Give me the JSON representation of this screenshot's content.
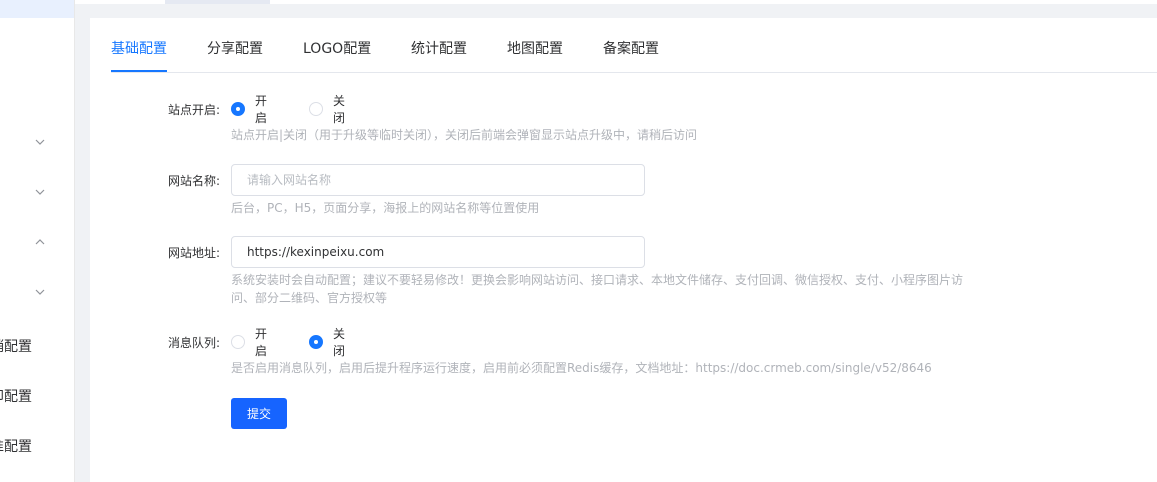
{
  "sidebar": {
    "labels": [
      "销配置",
      "印配置",
      "准配置"
    ]
  },
  "tabs": [
    {
      "label": "基础配置",
      "active": true
    },
    {
      "label": "分享配置",
      "active": false
    },
    {
      "label": "LOGO配置",
      "active": false
    },
    {
      "label": "统计配置",
      "active": false
    },
    {
      "label": "地图配置",
      "active": false
    },
    {
      "label": "备案配置",
      "active": false
    }
  ],
  "form": {
    "site_open": {
      "label": "站点开启:",
      "options": [
        "开启",
        "关闭"
      ],
      "selected": "开启",
      "tip": "站点开启|关闭（用于升级等临时关闭），关闭后前端会弹窗显示站点升级中，请稍后访问"
    },
    "site_name": {
      "label": "网站名称:",
      "value": "",
      "placeholder": "请输入网站名称",
      "tip": "后台，PC，H5，页面分享，海报上的网站名称等位置使用"
    },
    "site_url": {
      "label": "网站地址:",
      "value": "https://kexinpeixu.com",
      "tip": "系统安装时会自动配置；建议不要轻易修改！更换会影响网站访问、接口请求、本地文件储存、支付回调、微信授权、支付、小程序图片访问、部分二维码、官方授权等"
    },
    "queue": {
      "label": "消息队列:",
      "options": [
        "开启",
        "关闭"
      ],
      "selected": "关闭",
      "tip": "是否启用消息队列，启用后提升程序运行速度，启用前必须配置Redis缓存，文档地址：https://doc.crmeb.com/single/v52/8646"
    },
    "submit_label": "提交"
  },
  "colors": {
    "accent": "#1677ff",
    "button": "#1664ff",
    "tip": "#b0b3b9"
  }
}
